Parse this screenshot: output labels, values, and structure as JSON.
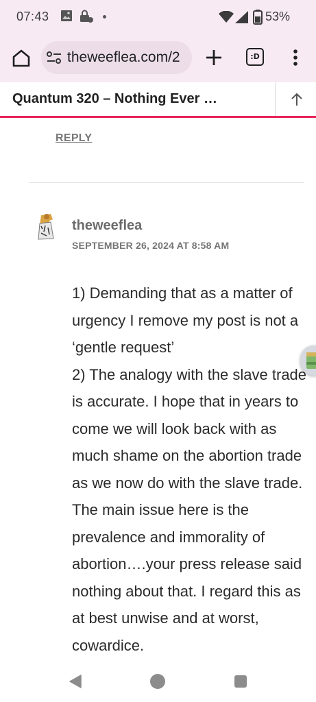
{
  "status_bar": {
    "time": "07:43",
    "battery": "53%",
    "icons": [
      "photo-icon",
      "lock-icon",
      "dot-icon",
      "wifi-icon",
      "signal-icon",
      "battery-icon"
    ]
  },
  "browser": {
    "url": "theweeflea.com/2",
    "buttons": [
      "home-icon",
      "plus-icon",
      "tabs-icon",
      "menu-icon"
    ],
    "tabs_label": ":D"
  },
  "site_header": {
    "title": "Quantum 320 – Nothing Ever …"
  },
  "previous_comment": {
    "reply_label": "REPLY"
  },
  "comment": {
    "author": "theweeflea",
    "date": "SEPTEMBER 26, 2024 AT 8:58 AM",
    "paragraphs": [
      "1) Demanding that as a matter of urgency I remove my post is not a ‘gentle request’",
      "2) The analogy with the slave trade is accurate. I hope that in years to come we will look back with as much shame on the abortion trade as we now do with the slave trade. The main issue here is the prevalence and immorality of abortion….your press release said nothing about that. I regard this as at best unwise and at worst, cowardice."
    ]
  },
  "colors": {
    "browser_bg": "#f7eaf3",
    "accent": "#e8245a",
    "meta_text": "#757575"
  }
}
